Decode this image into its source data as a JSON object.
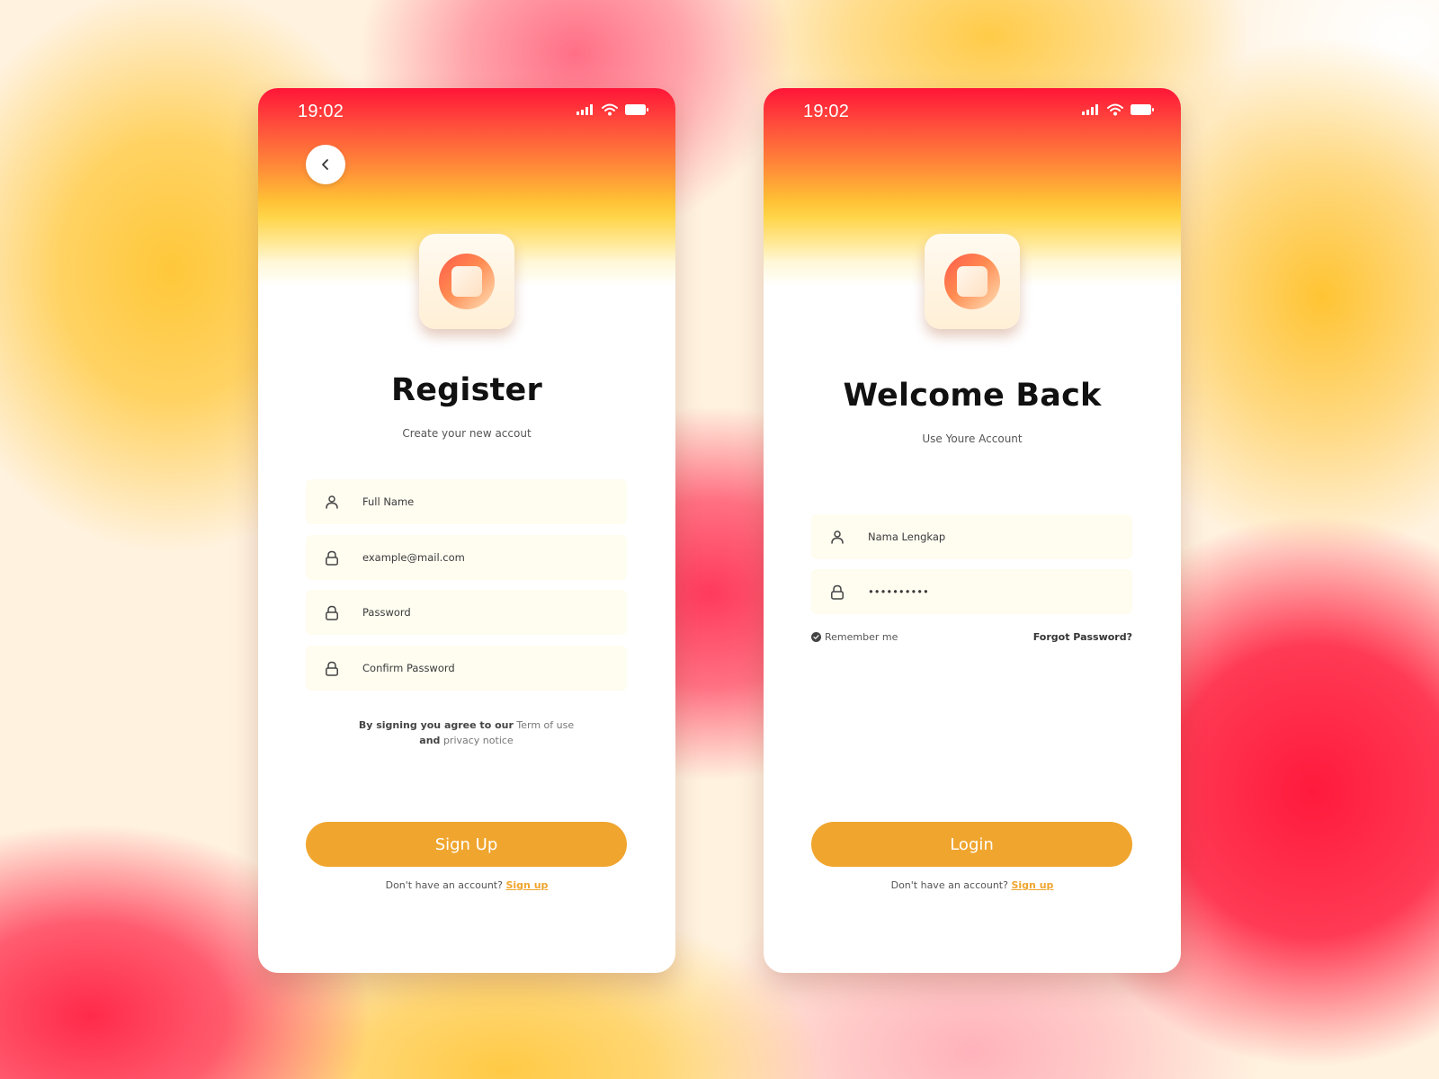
{
  "status_bar": {
    "time": "19:02"
  },
  "register": {
    "title": "Register",
    "subtitle": "Create your new accout",
    "fields": {
      "full_name_placeholder": "Full Name",
      "email_placeholder": "example@mail.com",
      "password_placeholder": "Password",
      "confirm_password_placeholder": "Confirm Password"
    },
    "terms": {
      "prefix": "By signing you agree to our",
      "term_link": "Term of use",
      "and": "and",
      "privacy_link": "privacy notice"
    },
    "button_label": "Sign Up",
    "no_account_text": "Don't have an account?",
    "signup_link": "Sign up"
  },
  "login": {
    "title": "Welcome Back",
    "subtitle": "Use Youre Account",
    "fields": {
      "name_placeholder": "Nama Lengkap",
      "password_value": "••••••••••"
    },
    "remember_label": "Remember me",
    "forgot_label": "Forgot Password?",
    "button_label": "Login",
    "no_account_text": "Don't have an account?",
    "signup_link": "Sign up"
  },
  "icons": {
    "back": "chevron-left-icon",
    "user": "user-icon",
    "lock": "lock-icon",
    "signal": "signal-icon",
    "wifi": "wifi-icon",
    "battery": "battery-icon",
    "check": "check-circle-icon",
    "logo": "app-logo-icon"
  },
  "colors": {
    "accent": "#f0a52e",
    "gradient_top": "#ff1538",
    "gradient_mid": "#ffbf35",
    "field_bg": "#fffcf0"
  }
}
